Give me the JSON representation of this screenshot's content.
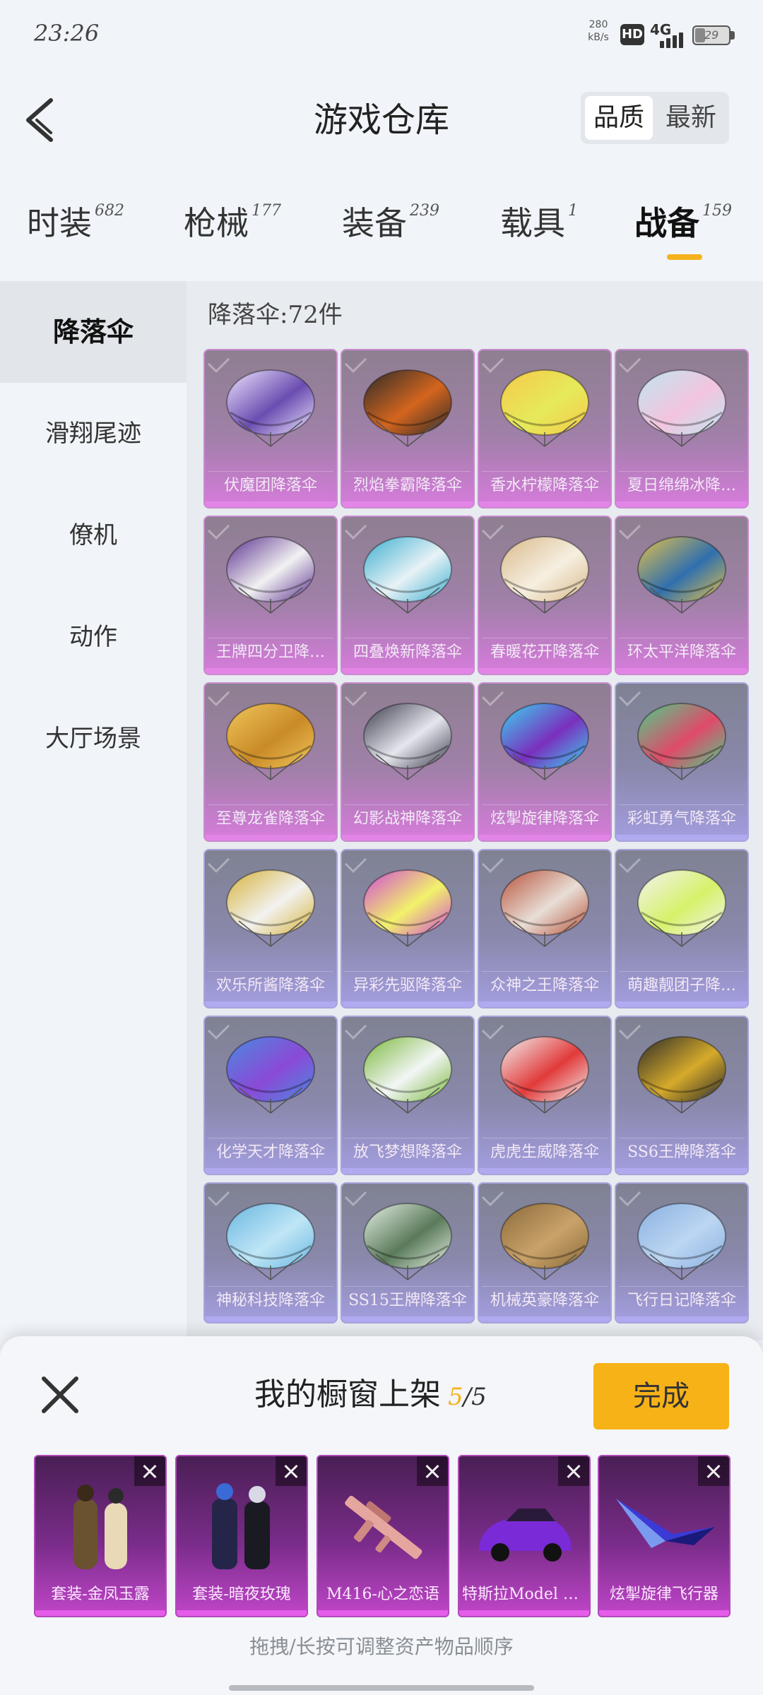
{
  "status_bar": {
    "time": "23:26",
    "net_speed_value": "280",
    "net_speed_unit": "kB/s",
    "hd_label": "HD",
    "signal_label": "4G",
    "battery": "29"
  },
  "header": {
    "title": "游戏仓库",
    "sort_options": [
      "品质",
      "最新"
    ],
    "active_sort": "品质"
  },
  "tabs": [
    {
      "label": "时装",
      "count": "682",
      "active": false
    },
    {
      "label": "枪械",
      "count": "177",
      "active": false
    },
    {
      "label": "装备",
      "count": "239",
      "active": false
    },
    {
      "label": "载具",
      "count": "1",
      "active": false
    },
    {
      "label": "战备",
      "count": "159",
      "active": true
    }
  ],
  "colors": {
    "accent": "#f6b21c",
    "legendary_card": "#d77bdc",
    "epic_card": "#a39ee0"
  },
  "sidebar": {
    "items": [
      {
        "label": "降落伞",
        "active": true
      },
      {
        "label": "滑翔尾迹",
        "active": false
      },
      {
        "label": "僚机",
        "active": false
      },
      {
        "label": "动作",
        "active": false
      },
      {
        "label": "大厅场景",
        "active": false
      }
    ]
  },
  "content": {
    "count_label": "降落伞:72件",
    "items": [
      {
        "name": "伏魔团降落伞",
        "tier": "pink",
        "palette": [
          "#6a4db0",
          "#efe6ff"
        ]
      },
      {
        "name": "烈焰拳霸降落伞",
        "tier": "pink",
        "palette": [
          "#d4651e",
          "#2a2a2a"
        ]
      },
      {
        "name": "香水柠檬降落伞",
        "tier": "pink",
        "palette": [
          "#e6ea5a",
          "#f6c94a"
        ]
      },
      {
        "name": "夏日绵绵冰降…",
        "tier": "pink",
        "palette": [
          "#f3c4de",
          "#bfe6f0"
        ]
      },
      {
        "name": "王牌四分卫降…",
        "tier": "pink",
        "palette": [
          "#f2f2f2",
          "#5a2f8e"
        ]
      },
      {
        "name": "四叠焕新降落伞",
        "tier": "pink",
        "palette": [
          "#e8f2f6",
          "#3aaed0"
        ]
      },
      {
        "name": "春暖花开降落伞",
        "tier": "pink",
        "palette": [
          "#f6efe0",
          "#d9b98a"
        ]
      },
      {
        "name": "环太平洋降落伞",
        "tier": "pink",
        "palette": [
          "#2f6fae",
          "#e6c24a"
        ]
      },
      {
        "name": "至尊龙雀降落伞",
        "tier": "pink",
        "palette": [
          "#c98a28",
          "#f0c65a"
        ]
      },
      {
        "name": "幻影战神降落伞",
        "tier": "pink",
        "palette": [
          "#e6e6ee",
          "#3a3a4a"
        ]
      },
      {
        "name": "炫掣旋律降落伞",
        "tier": "pink",
        "palette": [
          "#7a2fbe",
          "#3ad6f0"
        ]
      },
      {
        "name": "彩虹勇气降落伞",
        "tier": "blue",
        "palette": [
          "#e04a6a",
          "#4ad08a"
        ]
      },
      {
        "name": "欢乐所酱降落伞",
        "tier": "blue",
        "palette": [
          "#f2f2f0",
          "#d6b23a"
        ]
      },
      {
        "name": "异彩先驱降落伞",
        "tier": "blue",
        "palette": [
          "#f2f26a",
          "#d04ad6"
        ]
      },
      {
        "name": "众神之王降落伞",
        "tier": "blue",
        "palette": [
          "#e8ded6",
          "#b8523a"
        ]
      },
      {
        "name": "萌趣靓团子降…",
        "tier": "blue",
        "palette": [
          "#d6f26a",
          "#f2f2f0"
        ]
      },
      {
        "name": "化学天才降落伞",
        "tier": "blue",
        "palette": [
          "#8a4ad6",
          "#4a8ae0"
        ]
      },
      {
        "name": "放飞梦想降落伞",
        "tier": "blue",
        "palette": [
          "#f2f6f6",
          "#7ab83a"
        ]
      },
      {
        "name": "虎虎生威降落伞",
        "tier": "blue",
        "palette": [
          "#e23a3a",
          "#f2f2f2"
        ]
      },
      {
        "name": "SS6王牌降落伞",
        "tier": "blue",
        "palette": [
          "#d6aa2a",
          "#2a2a2a"
        ]
      },
      {
        "name": "神秘科技降落伞",
        "tier": "blue",
        "palette": [
          "#bfe6f6",
          "#6ab6e0"
        ]
      },
      {
        "name": "SS15王牌降落伞",
        "tier": "blue",
        "palette": [
          "#5a7a5a",
          "#e6f0e6"
        ]
      },
      {
        "name": "机械英豪降落伞",
        "tier": "blue",
        "palette": [
          "#c9a26a",
          "#8a6a3a"
        ]
      },
      {
        "name": "飞行日记降落伞",
        "tier": "blue",
        "palette": [
          "#bcd6f2",
          "#8ab0e0"
        ]
      }
    ]
  },
  "showcase": {
    "title": "我的橱窗上架",
    "current": "5",
    "total": "/5",
    "done_label": "完成",
    "items": [
      {
        "name": "套装-金凤玉露",
        "art": "outfit-gold"
      },
      {
        "name": "套装-暗夜玫瑰",
        "art": "outfit-dark"
      },
      {
        "name": "M416-心之恋语",
        "art": "rifle"
      },
      {
        "name": "特斯拉Model X(...",
        "art": "car"
      },
      {
        "name": "炫掣旋律飞行器",
        "art": "glider"
      }
    ],
    "hint": "拖拽/长按可调整资产物品顺序"
  }
}
